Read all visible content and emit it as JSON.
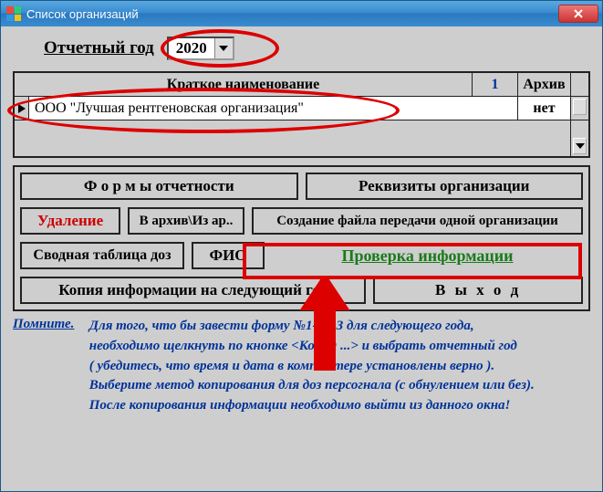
{
  "window": {
    "title": "Список организаций"
  },
  "year": {
    "label": "Отчетный год",
    "value": "2020"
  },
  "grid": {
    "header_name": "Краткое наименование",
    "header_count": "1",
    "header_archive": "Архив",
    "rows": [
      {
        "name": "ООО \"Лучшая рентгеновская организация\"",
        "archive": "нет"
      }
    ]
  },
  "buttons": {
    "forms": "Ф о р м ы    отчетности",
    "requisites": "Реквизиты    организации",
    "delete": "Удаление",
    "archive": "В архив\\Из ар..",
    "create_file": "Создание файла передачи одной организации",
    "dose_table": "Сводная таблица доз",
    "fio": "ФИО",
    "check": "Проверка   информации",
    "copy": "Копия информации на следующий год",
    "exit": "В  ы  х  о  д"
  },
  "note": {
    "heading": "Помните.",
    "line1": "Для того, что бы завести форму №1-ДОЗ для следующего года,",
    "line2": "необходимо щелкнуть по кнопке <Копия ...> и выбрать отчетный год",
    "line3": "( убедитесь, что время и дата в компьютере установлены верно ).",
    "line4": "Выберите метод копирования для доз персогнала (с обнулением или без).",
    "line5": "После копирования информации необходимо выйти из данного окна!"
  }
}
